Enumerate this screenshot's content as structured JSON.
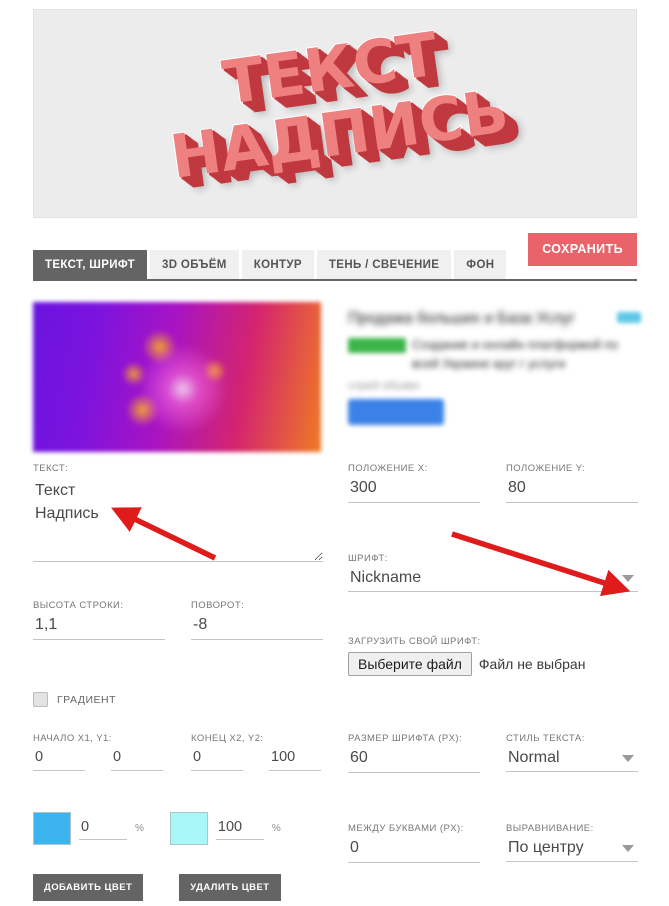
{
  "preview": {
    "text": "ТЕКСТ\nНАДПИСЬ",
    "fill_color": "#ef8080",
    "shadow_color": "#c0393f",
    "stroke_color": "#ffffff",
    "background": "#ececec"
  },
  "toolbar": {
    "save_label": "СОХРАНИТЬ",
    "save_color": "#e8646a"
  },
  "tabs": [
    {
      "label": "ТЕКСТ, ШРИФТ",
      "active": true
    },
    {
      "label": "3D ОБЪЁМ",
      "active": false
    },
    {
      "label": "КОНТУР",
      "active": false
    },
    {
      "label": "ТЕНЬ / СВЕЧЕНИЕ",
      "active": false
    },
    {
      "label": "ФОН",
      "active": false
    }
  ],
  "form": {
    "text": {
      "label": "ТЕКСТ:",
      "value": "Текст\nНадпись"
    },
    "position_x": {
      "label": "ПОЛОЖЕНИЕ X:",
      "value": "300"
    },
    "position_y": {
      "label": "ПОЛОЖЕНИЕ Y:",
      "value": "80"
    },
    "line_height": {
      "label": "ВЫСОТА СТРОКИ:",
      "value": "1,1"
    },
    "rotation": {
      "label": "ПОВОРОТ:",
      "value": "-8"
    },
    "font": {
      "label": "ШРИФТ:",
      "value": "Nickname",
      "options": [
        "Nickname"
      ]
    },
    "upload_font": {
      "label": "ЗАГРУЗИТЬ СВОЙ ШРИФТ:",
      "button_label": "Выберите файл",
      "status": "Файл не выбран"
    },
    "gradient": {
      "label": "ГРАДИЕНТ",
      "checked": false
    },
    "gradient_start": {
      "label": "НАЧАЛО X1, Y1:",
      "x": "0",
      "y": "0"
    },
    "gradient_end": {
      "label": "КОНЕЦ X2, Y2:",
      "x": "0",
      "y": "100"
    },
    "gradient_stops": [
      {
        "color": "#3cb4f0",
        "percent": "0",
        "unit": "%"
      },
      {
        "color": "#aaf7f7",
        "percent": "100",
        "unit": "%"
      }
    ],
    "add_color_label": "ДОБАВИТЬ ЦВЕТ",
    "remove_color_label": "УДАЛИТЬ ЦВЕТ",
    "font_size": {
      "label": "РАЗМЕР ШРИФТА (PX):",
      "value": "60"
    },
    "text_style": {
      "label": "СТИЛЬ ТЕКСТА:",
      "value": "Normal",
      "options": [
        "Normal"
      ]
    },
    "letter_spacing": {
      "label": "МЕЖДУ БУКВАМИ (PX):",
      "value": "0"
    },
    "alignment": {
      "label": "ВЫРАВНИВАНИЕ:",
      "value": "По центру",
      "options": [
        "По центру"
      ]
    }
  },
  "annotations": {
    "arrow_color": "#e01b1b",
    "arrow_count": 2
  }
}
